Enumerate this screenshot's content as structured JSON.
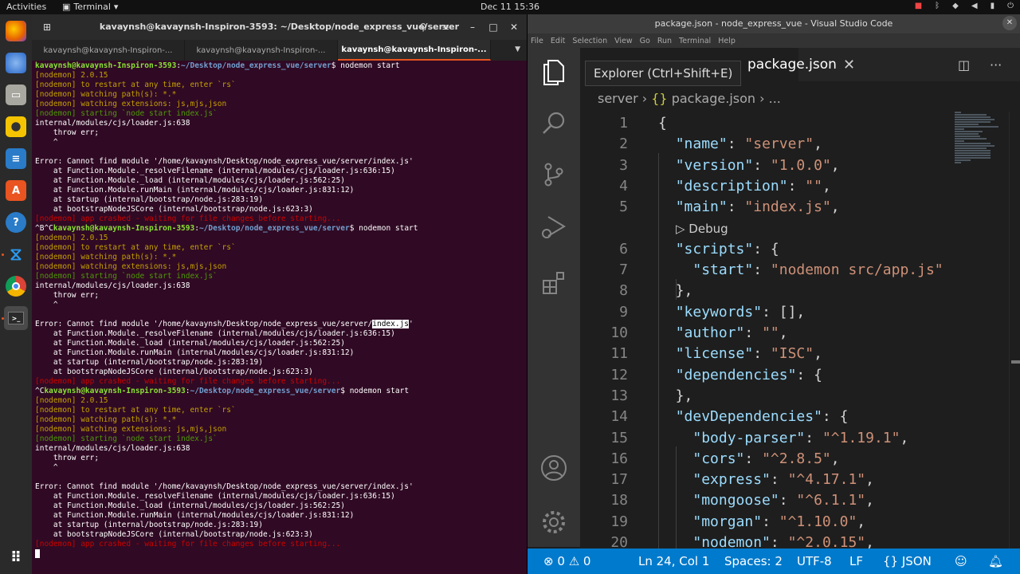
{
  "topbar": {
    "activities": "Activities",
    "app_name": "Terminal",
    "clock": "Dec 11  15:36"
  },
  "dock": {
    "items": [
      "firefox-icon",
      "thunderbird-icon",
      "files-icon",
      "rhythmbox-icon",
      "writer-icon",
      "software-center-icon",
      "help-icon",
      "vscode-icon",
      "chrome-icon",
      "terminal-icon"
    ]
  },
  "terminal": {
    "title": "kavaynsh@kavaynsh-Inspiron-3593: ~/Desktop/node_express_vue/server",
    "tabs": [
      "kavaynsh@kavaynsh-Inspiron-...",
      "kavaynsh@kavaynsh-Inspiron-...",
      "kavaynsh@kavaynsh-Inspiron-..."
    ],
    "lines": [
      {
        "p": "",
        "u": "kavaynsh@kavaynsh-Inspiron-3593",
        "s": ":",
        "d": "~/Desktop/node_express_vue/server",
        "c": "$ nodemon start"
      },
      {
        "y": "[nodemon] 2.0.15"
      },
      {
        "y": "[nodemon] to restart at any time, enter `rs`"
      },
      {
        "y": "[nodemon] watching path(s): *.*"
      },
      {
        "y": "[nodemon] watching extensions: js,mjs,json"
      },
      {
        "gn": "[nodemon] starting `node start index.js`"
      },
      {
        "t": "internal/modules/cjs/loader.js:638"
      },
      {
        "t": "    throw err;"
      },
      {
        "t": "    ^"
      },
      {
        "t": ""
      },
      {
        "t": "Error: Cannot find module '/home/kavaynsh/Desktop/node_express_vue/server/index.js'"
      },
      {
        "t": "    at Function.Module._resolveFilename (internal/modules/cjs/loader.js:636:15)"
      },
      {
        "t": "    at Function.Module._load (internal/modules/cjs/loader.js:562:25)"
      },
      {
        "t": "    at Function.Module.runMain (internal/modules/cjs/loader.js:831:12)"
      },
      {
        "t": "    at startup (internal/bootstrap/node.js:283:19)"
      },
      {
        "t": "    at bootstrapNodeJSCore (internal/bootstrap/node.js:623:3)"
      },
      {
        "r": "[nodemon] app crashed - waiting for file changes before starting..."
      },
      {
        "p": "^B^C",
        "u": "kavaynsh@kavaynsh-Inspiron-3593",
        "s": ":",
        "d": "~/Desktop/node_express_vue/server",
        "c": "$ nodemon start"
      },
      {
        "y": "[nodemon] 2.0.15"
      },
      {
        "y": "[nodemon] to restart at any time, enter `rs`"
      },
      {
        "y": "[nodemon] watching path(s): *.*"
      },
      {
        "y": "[nodemon] watching extensions: js,mjs,json"
      },
      {
        "gn": "[nodemon] starting `node start index.js`"
      },
      {
        "t": "internal/modules/cjs/loader.js:638"
      },
      {
        "t": "    throw err;"
      },
      {
        "t": "    ^"
      },
      {
        "t": ""
      },
      {
        "h1": "Error: Cannot find module '/home/kavaynsh/Desktop/node_express_vue/server/",
        "h2": "index.js",
        "h3": "'"
      },
      {
        "t": "    at Function.Module._resolveFilename (internal/modules/cjs/loader.js:636:15)"
      },
      {
        "t": "    at Function.Module._load (internal/modules/cjs/loader.js:562:25)"
      },
      {
        "t": "    at Function.Module.runMain (internal/modules/cjs/loader.js:831:12)"
      },
      {
        "t": "    at startup (internal/bootstrap/node.js:283:19)"
      },
      {
        "t": "    at bootstrapNodeJSCore (internal/bootstrap/node.js:623:3)"
      },
      {
        "r": "[nodemon] app crashed - waiting for file changes before starting..."
      },
      {
        "p": "^C",
        "u": "kavaynsh@kavaynsh-Inspiron-3593",
        "s": ":",
        "d": "~/Desktop/node_express_vue/server",
        "c": "$ nodemon start"
      },
      {
        "y": "[nodemon] 2.0.15"
      },
      {
        "y": "[nodemon] to restart at any time, enter `rs`"
      },
      {
        "y": "[nodemon] watching path(s): *.*"
      },
      {
        "y": "[nodemon] watching extensions: js,mjs,json"
      },
      {
        "gn": "[nodemon] starting `node start index.js`"
      },
      {
        "t": "internal/modules/cjs/loader.js:638"
      },
      {
        "t": "    throw err;"
      },
      {
        "t": "    ^"
      },
      {
        "t": ""
      },
      {
        "t": "Error: Cannot find module '/home/kavaynsh/Desktop/node_express_vue/server/index.js'"
      },
      {
        "t": "    at Function.Module._resolveFilename (internal/modules/cjs/loader.js:636:15)"
      },
      {
        "t": "    at Function.Module._load (internal/modules/cjs/loader.js:562:25)"
      },
      {
        "t": "    at Function.Module.runMain (internal/modules/cjs/loader.js:831:12)"
      },
      {
        "t": "    at startup (internal/bootstrap/node.js:283:19)"
      },
      {
        "t": "    at bootstrapNodeJSCore (internal/bootstrap/node.js:623:3)"
      },
      {
        "r": "[nodemon] app crashed - waiting for file changes before starting..."
      }
    ]
  },
  "vscode": {
    "title": "package.json - node_express_vue - Visual Studio Code",
    "menu": [
      "File",
      "Edit",
      "Selection",
      "View",
      "Go",
      "Run",
      "Terminal",
      "Help"
    ],
    "tooltip": "Explorer (Ctrl+Shift+E)",
    "tab_name": "package.json",
    "breadcrumb": {
      "folder": "server",
      "brace": "{}",
      "file": "package.json",
      "more": "..."
    },
    "code_lines": [
      {
        "n": "1",
        "t": [
          [
            "p",
            "{"
          ]
        ]
      },
      {
        "n": "2",
        "t": [
          [
            "p",
            "  "
          ],
          [
            "k",
            "\"name\""
          ],
          [
            "p",
            ": "
          ],
          [
            "s",
            "\"server\""
          ],
          [
            "p",
            ","
          ]
        ]
      },
      {
        "n": "3",
        "t": [
          [
            "p",
            "  "
          ],
          [
            "k",
            "\"version\""
          ],
          [
            "p",
            ": "
          ],
          [
            "s",
            "\"1.0.0\""
          ],
          [
            "p",
            ","
          ]
        ]
      },
      {
        "n": "4",
        "t": [
          [
            "p",
            "  "
          ],
          [
            "k",
            "\"description\""
          ],
          [
            "p",
            ": "
          ],
          [
            "s",
            "\"\""
          ],
          [
            "p",
            ","
          ]
        ]
      },
      {
        "n": "5",
        "t": [
          [
            "p",
            "  "
          ],
          [
            "k",
            "\"main\""
          ],
          [
            "p",
            ": "
          ],
          [
            "s",
            "\"index.js\""
          ],
          [
            "p",
            ","
          ]
        ]
      },
      {
        "n": "",
        "dbg": "▷ Debug"
      },
      {
        "n": "6",
        "t": [
          [
            "p",
            "  "
          ],
          [
            "k",
            "\"scripts\""
          ],
          [
            "p",
            ": {"
          ]
        ]
      },
      {
        "n": "7",
        "t": [
          [
            "p",
            "    "
          ],
          [
            "k",
            "\"start\""
          ],
          [
            "p",
            ": "
          ],
          [
            "s",
            "\"nodemon src/app.js\""
          ]
        ]
      },
      {
        "n": "8",
        "t": [
          [
            "p",
            "  },"
          ]
        ]
      },
      {
        "n": "9",
        "t": [
          [
            "p",
            "  "
          ],
          [
            "k",
            "\"keywords\""
          ],
          [
            "p",
            ": [],"
          ]
        ]
      },
      {
        "n": "10",
        "t": [
          [
            "p",
            "  "
          ],
          [
            "k",
            "\"author\""
          ],
          [
            "p",
            ": "
          ],
          [
            "s",
            "\"\""
          ],
          [
            "p",
            ","
          ]
        ]
      },
      {
        "n": "11",
        "t": [
          [
            "p",
            "  "
          ],
          [
            "k",
            "\"license\""
          ],
          [
            "p",
            ": "
          ],
          [
            "s",
            "\"ISC\""
          ],
          [
            "p",
            ","
          ]
        ]
      },
      {
        "n": "12",
        "t": [
          [
            "p",
            "  "
          ],
          [
            "k",
            "\"dependencies\""
          ],
          [
            "p",
            ": {"
          ]
        ]
      },
      {
        "n": "13",
        "t": [
          [
            "p",
            "  },"
          ]
        ]
      },
      {
        "n": "14",
        "t": [
          [
            "p",
            "  "
          ],
          [
            "k",
            "\"devDependencies\""
          ],
          [
            "p",
            ": {"
          ]
        ]
      },
      {
        "n": "15",
        "t": [
          [
            "p",
            "    "
          ],
          [
            "k",
            "\"body-parser\""
          ],
          [
            "p",
            ": "
          ],
          [
            "s",
            "\"^1.19.1\""
          ],
          [
            "p",
            ","
          ]
        ]
      },
      {
        "n": "16",
        "t": [
          [
            "p",
            "    "
          ],
          [
            "k",
            "\"cors\""
          ],
          [
            "p",
            ": "
          ],
          [
            "s",
            "\"^2.8.5\""
          ],
          [
            "p",
            ","
          ]
        ]
      },
      {
        "n": "17",
        "t": [
          [
            "p",
            "    "
          ],
          [
            "k",
            "\"express\""
          ],
          [
            "p",
            ": "
          ],
          [
            "s",
            "\"^4.17.1\""
          ],
          [
            "p",
            ","
          ]
        ]
      },
      {
        "n": "18",
        "t": [
          [
            "p",
            "    "
          ],
          [
            "k",
            "\"mongoose\""
          ],
          [
            "p",
            ": "
          ],
          [
            "s",
            "\"^6.1.1\""
          ],
          [
            "p",
            ","
          ]
        ]
      },
      {
        "n": "19",
        "t": [
          [
            "p",
            "    "
          ],
          [
            "k",
            "\"morgan\""
          ],
          [
            "p",
            ": "
          ],
          [
            "s",
            "\"^1.10.0\""
          ],
          [
            "p",
            ","
          ]
        ]
      },
      {
        "n": "20",
        "t": [
          [
            "p",
            "    "
          ],
          [
            "k",
            "\"nodemon\""
          ],
          [
            "p",
            ": "
          ],
          [
            "s",
            "\"^2.0.15\""
          ],
          [
            "p",
            ","
          ]
        ]
      }
    ],
    "status": {
      "errors": "0",
      "warnings": "0",
      "position": "Ln 24, Col 1",
      "spaces": "Spaces: 2",
      "encoding": "UTF-8",
      "eol": "LF",
      "language_brace": "{}",
      "language": "JSON"
    }
  },
  "colors": {
    "terminal_bg": "#300a24",
    "accent": "#e95420",
    "vscode_status": "#007acc"
  }
}
